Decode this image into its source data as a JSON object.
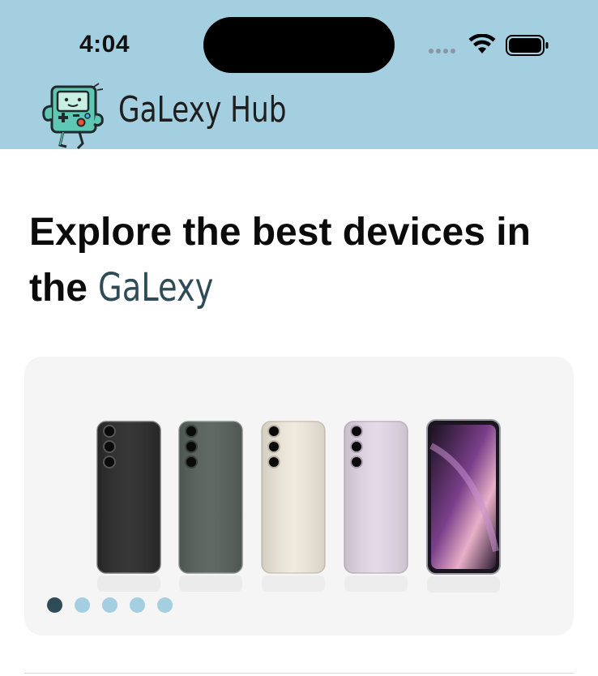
{
  "status_bar": {
    "time": "4:04"
  },
  "header": {
    "brand": "GaLexy Hub",
    "logo_icon": "bmo-robot-icon",
    "background": "#a4cfe0"
  },
  "hero": {
    "headline_prefix": "Explore the best devices in the ",
    "headline_accent": "GaLexy",
    "accent_color": "#2f4b56"
  },
  "carousel": {
    "slide_count": 5,
    "active_index": 0,
    "image_description_icon": "galaxy-phones-lineup-image",
    "phone_colors": [
      "#2a2a2a",
      "#56605a",
      "#efe9dc",
      "#e3d8e6",
      "#1b1520"
    ]
  }
}
